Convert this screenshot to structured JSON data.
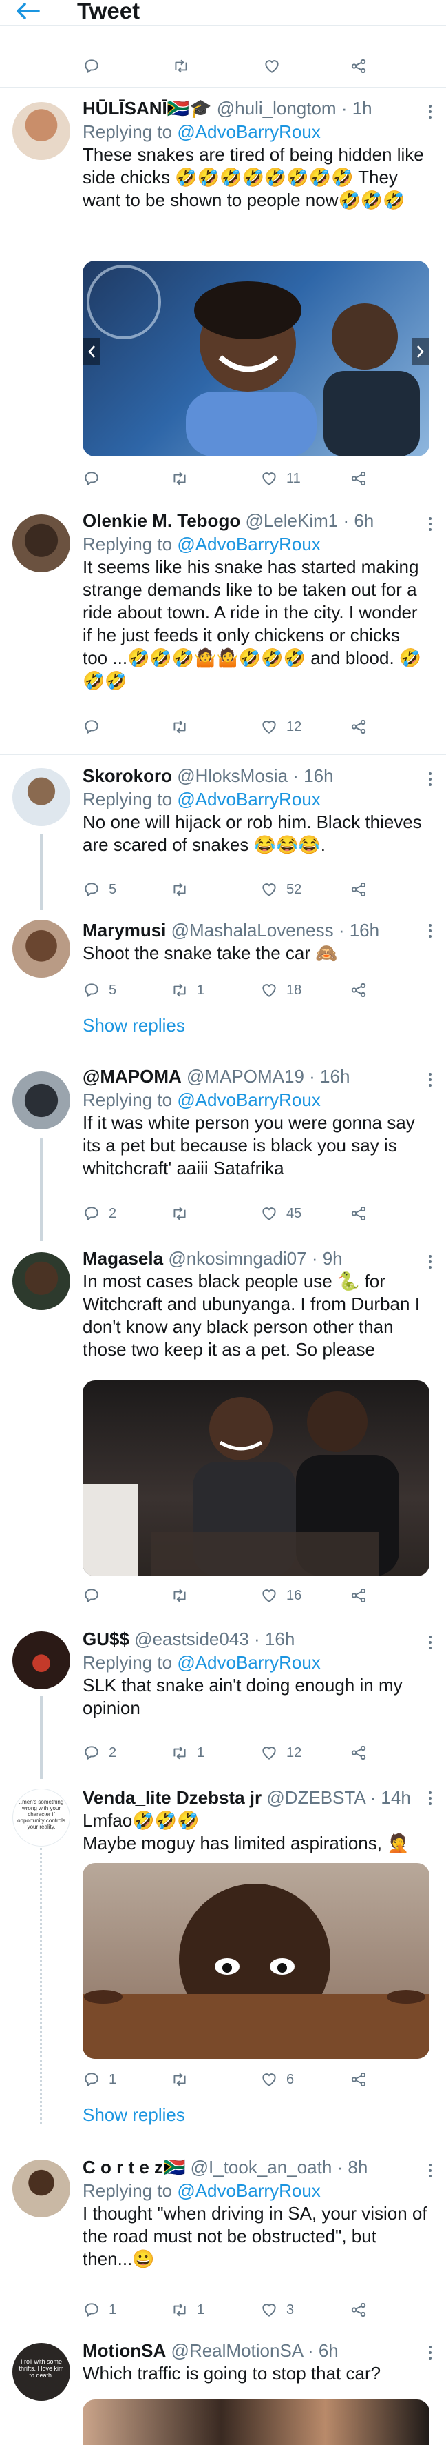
{
  "header": {
    "title": "Tweet"
  },
  "top_stub": {
    "retweets": "",
    "likes": ""
  },
  "tweets": [
    {
      "name": "HŪLĪSANĪ",
      "name_suffix": "🇿🇦🎓",
      "handle": "@huli_longtom",
      "time": "· 1h",
      "replying_prefix": "Replying to",
      "replying_to": "@AdvoBarryRoux",
      "text": "These snakes are tired of being hidden like side chicks 🤣🤣🤣🤣🤣🤣🤣🤣 They want to be shown to people now🤣🤣🤣",
      "likes": "11",
      "retweets": "",
      "replies": ""
    },
    {
      "name": "Olenkie M. Tebogo",
      "handle": "@LeleKim1",
      "time": "· 6h",
      "replying_prefix": "Replying to",
      "replying_to": "@AdvoBarryRoux",
      "text": "It seems like his snake has started making strange demands like to be taken out for a ride about town. A ride in the city. I wonder if he just feeds it only chickens or chicks too ...🤣🤣🤣🤷🤷🤣🤣🤣 and blood. 🤣🤣🤣",
      "likes": "12",
      "retweets": "",
      "replies": ""
    },
    {
      "name": "Skorokoro",
      "handle": "@HloksMosia",
      "time": "· 16h",
      "replying_prefix": "Replying to",
      "replying_to": "@AdvoBarryRoux",
      "text": "No one will hijack or rob him. Black thieves are scared of snakes 😂😂😂.",
      "likes": "52",
      "retweets": "",
      "replies": "5"
    },
    {
      "name": "Marymusi",
      "handle": "@MashalaLoveness",
      "time": "· 16h",
      "text": "Shoot the snake take the car 🙈",
      "likes": "18",
      "retweets": "1",
      "replies": "5",
      "show_replies": "Show replies"
    },
    {
      "name": "@MAPOMA",
      "handle": "@MAPOMA19",
      "time": "· 16h",
      "replying_prefix": "Replying to",
      "replying_to": "@AdvoBarryRoux",
      "text": "If it was white person you were gonna say its a pet but because is black you say is whitchcraft' aaiii Satafrika",
      "likes": "45",
      "retweets": "",
      "replies": "2"
    },
    {
      "name": "Magasela",
      "handle": "@nkosimngadi07",
      "time": "· 9h",
      "text": "In most cases black people use 🐍 for Witchcraft and ubunyanga. I from Durban I don't know any black person other than those two keep it as a pet. So please",
      "likes": "16",
      "retweets": "",
      "replies": ""
    },
    {
      "name": "GU$$",
      "handle": "@eastside043",
      "time": "· 16h",
      "replying_prefix": "Replying to",
      "replying_to": "@AdvoBarryRoux",
      "text": "SLK that snake ain't doing enough in my opinion",
      "likes": "12",
      "retweets": "1",
      "replies": "2"
    },
    {
      "name": "Venda_lite Dzebsta jr",
      "handle": "@DZEBSTA",
      "time": "· 14h",
      "text_line1": "Lmfao🤣🤣🤣",
      "text": "Maybe moguy has limited aspirations, 🤦",
      "likes": "6",
      "retweets": "",
      "replies": "1",
      "show_replies": "Show replies",
      "avatar_text": "..men's something wrong with your character if opportunity controls your reality."
    },
    {
      "name": "C o r t e z",
      "name_suffix": "🇿🇦",
      "handle": "@I_took_an_oath",
      "time": "· 8h",
      "replying_prefix": "Replying to",
      "replying_to": "@AdvoBarryRoux",
      "text": "I thought \"when driving in SA, your vision of the road must not be obstructed\", but then...😀",
      "likes": "3",
      "retweets": "1",
      "replies": "1"
    },
    {
      "name": "MotionSA",
      "handle": "@RealMotionSA",
      "time": "· 6h",
      "text": "Which traffic is going to stop that car?",
      "avatar_text": "I roll with some thrifts. I love kim to death."
    }
  ],
  "colors": {
    "accent": "#1b95e0",
    "muted": "#657786",
    "divider": "#e6ecf0"
  },
  "icons": [
    "back-arrow-icon",
    "reply-icon",
    "retweet-icon",
    "like-icon",
    "share-icon",
    "more-icon"
  ]
}
